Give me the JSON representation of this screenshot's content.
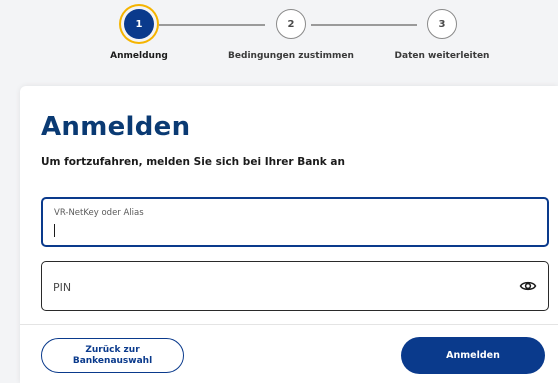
{
  "stepper": {
    "steps": [
      {
        "number": "1",
        "label": "Anmeldung",
        "state": "active"
      },
      {
        "number": "2",
        "label": "Bedingungen zustimmen",
        "state": "inactive"
      },
      {
        "number": "3",
        "label": "Daten weiterleiten",
        "state": "inactive"
      }
    ]
  },
  "login": {
    "title": "Anmelden",
    "subtitle": "Um fortzufahren, melden Sie sich bei Ihrer Bank an",
    "netkey_label": "VR-NetKey oder Alias",
    "pin_placeholder": "PIN"
  },
  "actions": {
    "back_label": "Zurück zur Bankenauswahl",
    "login_label": "Anmelden"
  },
  "colors": {
    "primary": "#0a3a8c",
    "title": "#0a3a73",
    "active_step_ring": "#f5b400"
  },
  "icons": {
    "pin_toggle": "eye-icon"
  }
}
